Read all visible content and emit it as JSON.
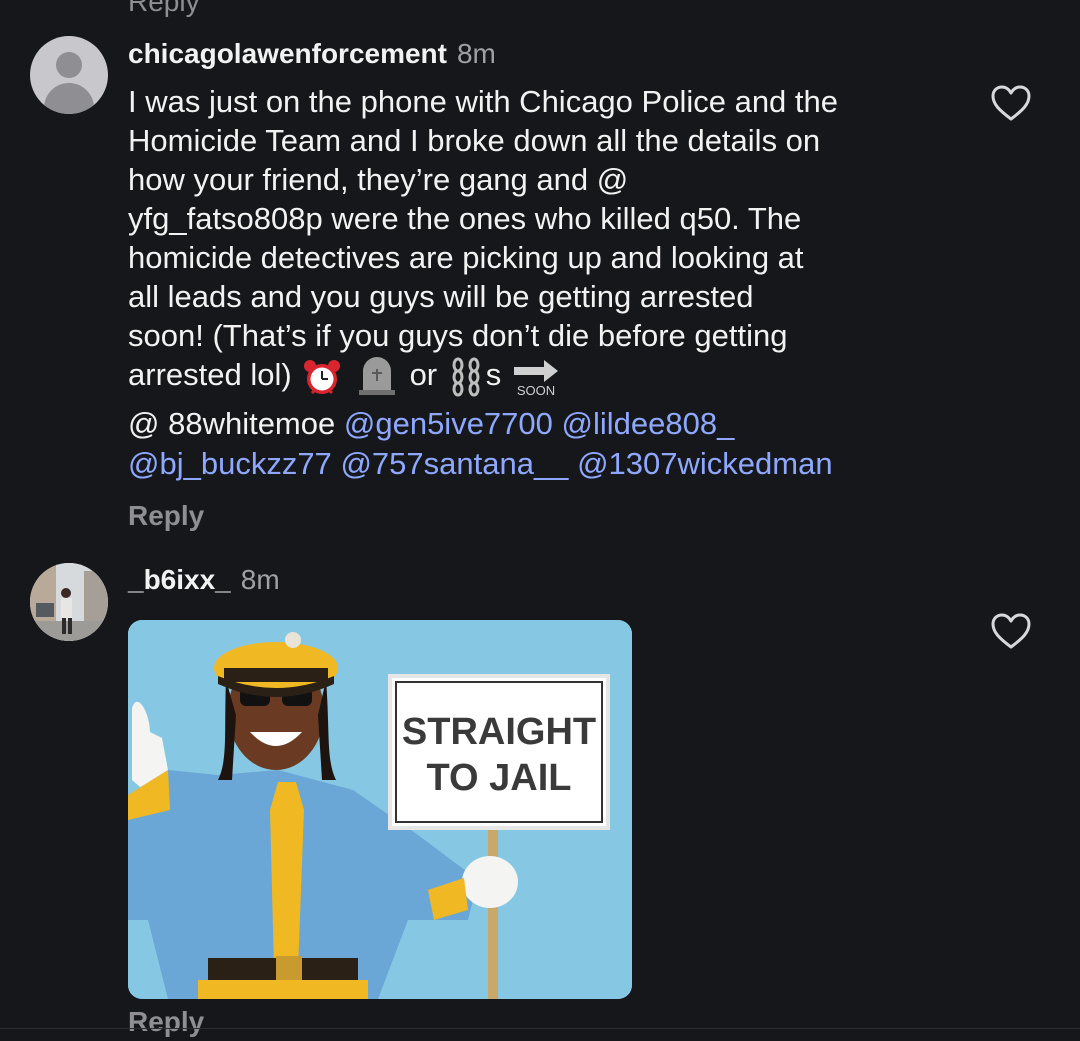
{
  "top_partial_text": "Reply",
  "comments": [
    {
      "username": "chicagolawenforcement",
      "time": "8m",
      "lines": [
        "I was just on the phone with Chicago Police and the",
        "Homicide Team and I broke down all the details on",
        "how your friend, they’re gang and @",
        "yfg_fatso808p were the ones who killed q50. The",
        "homicide detectives are picking up and looking at",
        "all leads and you guys will be getting arrested",
        "soon! (That’s if you guys don’t die before getting"
      ],
      "last_line": {
        "prefix": "arrested lol)",
        "or": "or",
        "s": "s",
        "emojis": [
          "alarm-clock",
          "headstone",
          "chains",
          "soon-arrow"
        ]
      },
      "mentions": {
        "plain": "@ 88whitemoe",
        "linked": [
          "@gen5ive7700",
          "@lildee808_",
          "@bj_buckzz77",
          "@757santana__",
          "@1307wickedman"
        ]
      },
      "reply_label": "Reply"
    },
    {
      "username": "_b6ixx_",
      "time": "8m",
      "image": {
        "sign_line1": "STRAIGHT",
        "sign_line2": "TO JAIL"
      },
      "reply_label": "Reply"
    }
  ],
  "colors": {
    "background": "#16171b",
    "text": "#f2f2f2",
    "muted": "#8e8e93",
    "mention": "#8fa8ff"
  }
}
